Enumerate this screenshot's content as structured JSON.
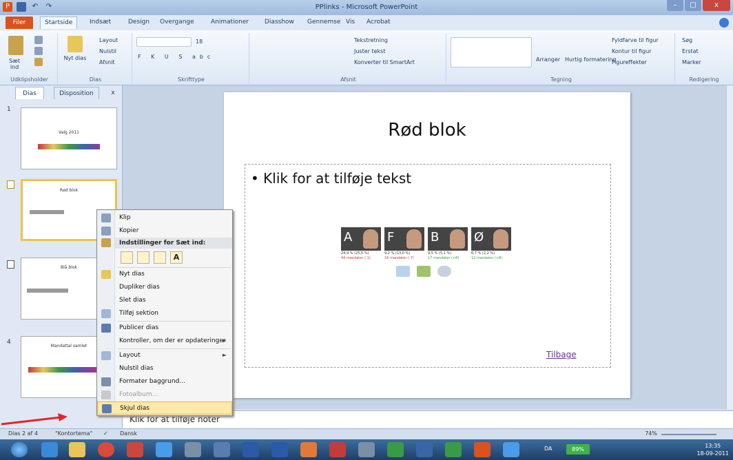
{
  "window": {
    "title": "PPlinks - Microsoft PowerPoint",
    "controls": [
      "–",
      "□",
      "x"
    ]
  },
  "ribbon_tabs": [
    "Filer",
    "Startside",
    "Indsæt",
    "Design",
    "Overgange",
    "Animationer",
    "Diasshow",
    "Gennemse",
    "Vis",
    "Acrobat"
  ],
  "ribbon": {
    "groups": [
      "Udklipsholder",
      "Dias",
      "Skrifttype",
      "Afsnit",
      "Tegning",
      "Redigering"
    ],
    "paste_label": "Sæt ind",
    "new_slide_label": "Nyt dias",
    "layout": "Layout",
    "reset": "Nulstil",
    "section": "Afsnit",
    "font_size": "18",
    "text_direction": "Tekstretning",
    "align_text": "Juster tekst",
    "convert_smartart": "Konverter til SmartArt",
    "arrange": "Arranger",
    "quick_styles": "Hurtig formatering",
    "shape_fill": "Fyldfarve til figur",
    "shape_outline": "Kontur til figur",
    "shape_effects": "Figureffekter",
    "find": "Søg",
    "replace": "Erstat",
    "select": "Marker"
  },
  "slide_panel": {
    "tabs": [
      "Dias",
      "Disposition"
    ],
    "close": "x",
    "slides": [
      {
        "num": "1",
        "title": "Valg 2011"
      },
      {
        "num": "2",
        "title": "Rød blok"
      },
      {
        "num": "3",
        "title": "Blå blok"
      },
      {
        "num": "4",
        "title": "Mandattal samlet"
      }
    ]
  },
  "slide": {
    "title": "Rød blok",
    "bullet": "Klik for at tilføje tekst",
    "link": "Tilbage",
    "parties": [
      {
        "letter": "A",
        "line1": "24,9 % (25,5 %)",
        "line2": "44 mandater (-1)",
        "color": "#c43b3b"
      },
      {
        "letter": "F",
        "line1": "9,2 % (13,0 %)",
        "line2": "16 mandater (-7)",
        "color": "#c43b3b"
      },
      {
        "letter": "B",
        "line1": "9,5 % (5,1 %)",
        "line2": "17 mandater (+8)",
        "color": "#3a9b45"
      },
      {
        "letter": "Ø",
        "line1": "6,7 % (2,2 %)",
        "line2": "12 mandater (+8)",
        "color": "#3a9b45"
      }
    ]
  },
  "notes_placeholder": "Klik for at tilføje noter",
  "context_menu": {
    "items": [
      {
        "label": "Klip",
        "icon": "scissors-icon"
      },
      {
        "label": "Kopier",
        "icon": "copy-icon"
      },
      {
        "label": "Indstillinger for Sæt ind:",
        "type": "header"
      },
      {
        "label": "Nyt dias",
        "icon": "new-slide-icon"
      },
      {
        "label": "Dupliker dias"
      },
      {
        "label": "Slet dias"
      },
      {
        "label": "Tilføj sektion",
        "icon": "section-icon"
      },
      {
        "label": "Publicer dias",
        "icon": "publish-icon"
      },
      {
        "label": "Kontroller, om der er opdateringer",
        "submenu": true
      },
      {
        "label": "Layout",
        "icon": "layout-icon",
        "submenu": true
      },
      {
        "label": "Nulstil dias"
      },
      {
        "label": "Formater baggrund...",
        "icon": "background-icon"
      },
      {
        "label": "Fotoalbum...",
        "icon": "photo-album-icon",
        "disabled": true
      },
      {
        "label": "Skjul dias",
        "icon": "hide-slide-icon",
        "highlighted": true
      }
    ],
    "paste_options": [
      "",
      "",
      "",
      "A"
    ],
    "submenu_arrow": "►"
  },
  "status_bar": {
    "slide_info": "Dias 2 af 4",
    "theme": "\"Kontortema\"",
    "language": "Dansk",
    "zoom": "74%"
  },
  "taskbar": {
    "battery": "89%",
    "language": "DA",
    "time": "13:35",
    "date": "18-09-2011"
  },
  "colors": {
    "accent": "#d9531e",
    "ribbon_bg": "#dde8f5",
    "highlight": "#fde9a8",
    "arrow": "#e8232a"
  }
}
